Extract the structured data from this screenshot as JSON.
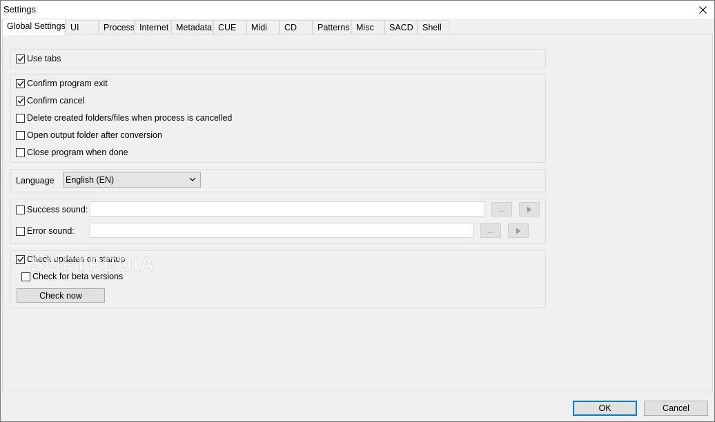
{
  "window": {
    "title": "Settings"
  },
  "tabs": [
    "Global Settings",
    "UI",
    "Process",
    "Internet",
    "Metadata",
    "CUE",
    "Midi",
    "CD",
    "Patterns",
    "Misc",
    "SACD",
    "Shell"
  ],
  "active_tab": "Global Settings",
  "general": {
    "use_tabs": {
      "label": "Use tabs",
      "checked": true
    }
  },
  "behavior": {
    "confirm_exit": {
      "label": "Confirm program exit",
      "checked": true
    },
    "confirm_cancel": {
      "label": "Confirm cancel",
      "checked": true
    },
    "delete_created": {
      "label": "Delete created folders/files when process is cancelled",
      "checked": false
    },
    "open_output": {
      "label": "Open output folder after conversion",
      "checked": false
    },
    "close_when_done": {
      "label": "Close program when done",
      "checked": false
    }
  },
  "language": {
    "label": "Language",
    "value": "English (EN)"
  },
  "sounds": {
    "success": {
      "label": "Success sound:",
      "checked": false,
      "value": "",
      "browse_label": "..."
    },
    "error": {
      "label": "Error sound:",
      "checked": false,
      "value": "",
      "browse_label": "..."
    }
  },
  "updates": {
    "check_startup": {
      "label": "Check updates on startup",
      "checked": true
    },
    "check_beta": {
      "label": "Check for beta versions",
      "checked": false
    },
    "check_now_label": "Check now"
  },
  "watermark": "SOFTPEDIA",
  "footer": {
    "ok_label": "OK",
    "cancel_label": "Cancel"
  },
  "colors": {
    "accent": "#0078d7",
    "panel_bg": "#f0f0f0",
    "titlebar_bg": "#ffffff"
  }
}
